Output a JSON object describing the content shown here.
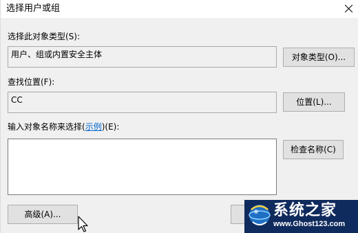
{
  "window": {
    "title": "选择用户或组"
  },
  "object_type": {
    "label": "选择此对象类型(S):",
    "value": "用户、组或内置安全主体",
    "button_label": "对象类型(O)..."
  },
  "location": {
    "label": "查找位置(F):",
    "value": "CC",
    "button_label": "位置(L)..."
  },
  "object_names": {
    "label_prefix": "输入对象名称来选择(",
    "label_link": "示例",
    "label_suffix": ")(E):",
    "value": "",
    "check_names_label": "检查名称(C)"
  },
  "advanced": {
    "button_label": "高级(A)..."
  },
  "watermark": {
    "name": "系统之家",
    "url": "www.Ghost123.com"
  },
  "icons": {
    "close": "close-icon",
    "cursor": "mouse-pointer-icon",
    "logo": "globe-logo-icon"
  }
}
